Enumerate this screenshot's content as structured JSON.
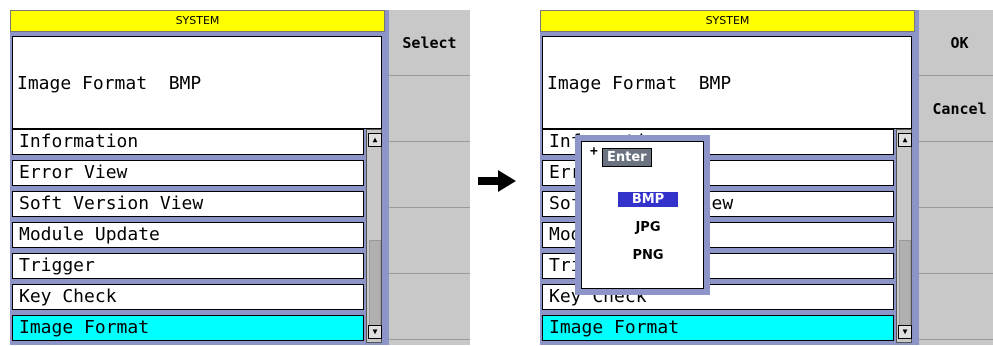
{
  "screens": [
    {
      "title": "SYSTEM",
      "info": "Image Format  BMP",
      "menu": [
        "Information",
        "Error View",
        "Soft Version View",
        "Module Update",
        "Trigger",
        "Key Check",
        "Image Format"
      ],
      "selected_index": 6,
      "side_buttons": [
        "Select",
        "",
        "",
        "",
        ""
      ]
    },
    {
      "title": "SYSTEM",
      "info": "Image Format  BMP",
      "menu": [
        "Information",
        "Error View",
        "Soft Version View",
        "Module Update",
        "Trigger",
        "Key Check",
        "Image Format"
      ],
      "selected_index": 6,
      "side_buttons": [
        "OK",
        "Cancel",
        "",
        "",
        ""
      ]
    }
  ],
  "popup": {
    "enter_label": "Enter",
    "plus_glyph": "+",
    "options": [
      "BMP",
      "JPG",
      "PNG"
    ],
    "selected": "BMP"
  },
  "icons": {
    "transition": "arrow-right-icon"
  },
  "colors": {
    "title_bar": "#ffff00",
    "selected_row": "#00ffff",
    "frame": "#8c94c8"
  }
}
